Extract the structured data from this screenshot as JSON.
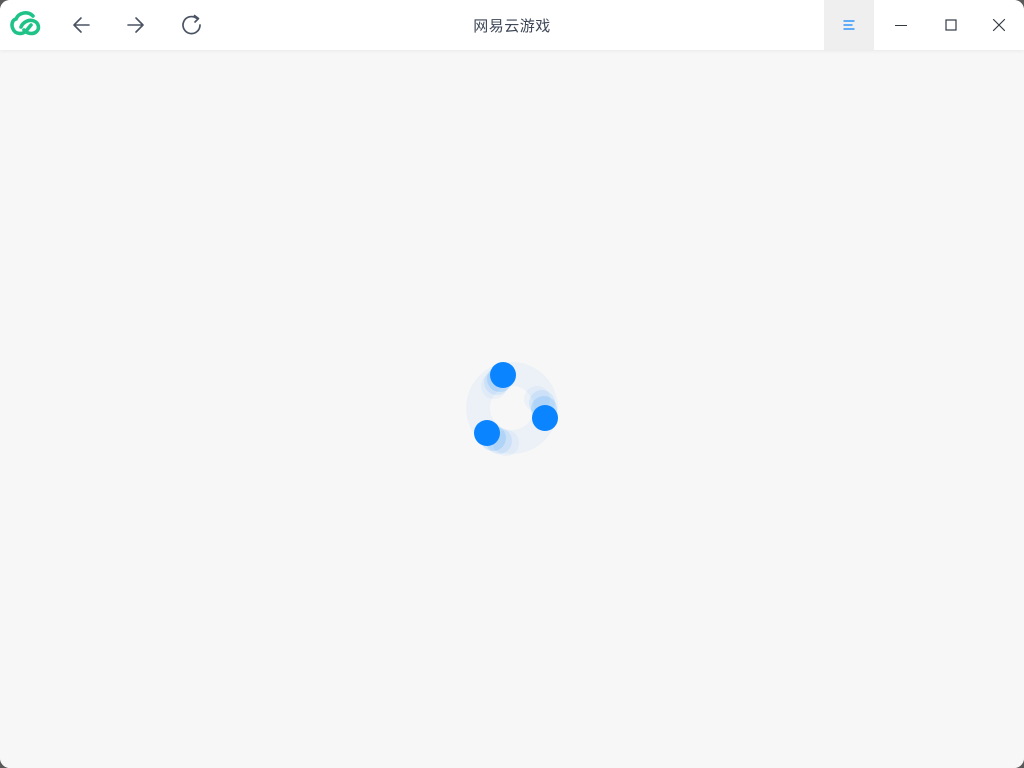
{
  "window": {
    "title": "网易云游戏"
  },
  "toolbar": {
    "logo_icon": "netease-cloud-gaming-logo",
    "back_icon": "arrow-left-icon",
    "forward_icon": "arrow-right-icon",
    "reload_icon": "reload-icon"
  },
  "window_controls": {
    "menu_icon": "menu-icon",
    "minimize_icon": "minimize-icon",
    "maximize_icon": "maximize-icon",
    "close_icon": "close-icon"
  },
  "content": {
    "state": "loading",
    "spinner_icon": "loading-spinner"
  },
  "colors": {
    "brand_green": "#1fc287",
    "accent_blue": "#0a84ff",
    "titlebar_bg": "#ffffff",
    "content_bg": "#f7f7f7",
    "icon_gray": "#4a5363",
    "title_text": "#3d4757"
  }
}
